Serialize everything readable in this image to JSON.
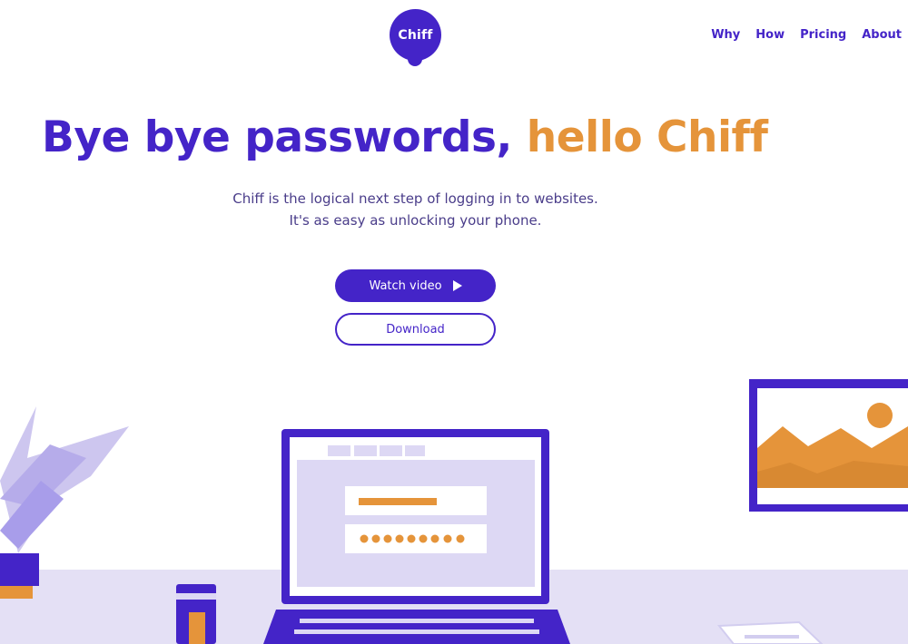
{
  "header": {
    "logo_text": "Chiff",
    "nav": [
      {
        "label": "Why"
      },
      {
        "label": "How"
      },
      {
        "label": "Pricing"
      },
      {
        "label": "About"
      }
    ]
  },
  "hero": {
    "headline_part1": "Bye bye passwords,",
    "headline_part2": "hello Chiff",
    "subtitle_line1": "Chiff is the logical next step of logging in to websites.",
    "subtitle_line2": "It's as easy as unlocking your phone.",
    "watch_button": "Watch video",
    "download_button": "Download"
  },
  "colors": {
    "brand_purple": "#4424c8",
    "accent_orange": "#e5943a",
    "lavender": "#dcd7f3"
  },
  "illustration": {
    "icons": [
      "plant-icon",
      "laptop-icon",
      "picture-frame-icon",
      "cup-icon",
      "papers-icon"
    ],
    "password_dots": 9
  }
}
